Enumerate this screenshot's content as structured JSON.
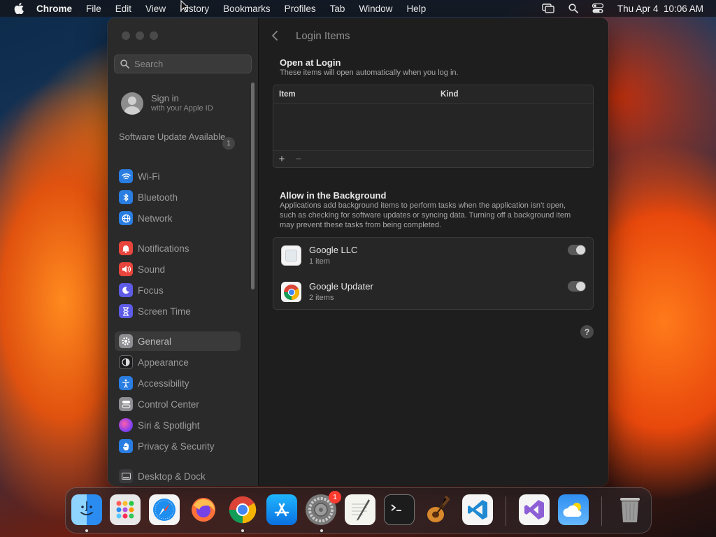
{
  "menubar": {
    "app_name": "Chrome",
    "items": [
      "File",
      "Edit",
      "View",
      "History",
      "Bookmarks",
      "Profiles",
      "Tab",
      "Window",
      "Help"
    ],
    "clock": "Thu Apr 4  10:06 AM",
    "status_icons": [
      "screen-mirroring-icon",
      "spotlight-search-icon",
      "control-center-icon"
    ]
  },
  "sidebar": {
    "search_placeholder": "Search",
    "account": {
      "title": "Sign in",
      "subtitle": "with your Apple ID"
    },
    "software_update": {
      "label": "Software Update Available",
      "badge": "1"
    },
    "items": [
      {
        "label": "Wi-Fi",
        "icon": "wifi-icon",
        "color": "#2a7de1"
      },
      {
        "label": "Bluetooth",
        "icon": "bluetooth-icon",
        "color": "#2a7de1"
      },
      {
        "label": "Network",
        "icon": "globe-icon",
        "color": "#2a7de1"
      },
      {
        "label": "Notifications",
        "icon": "bell-icon",
        "color": "#e8453c"
      },
      {
        "label": "Sound",
        "icon": "speaker-icon",
        "color": "#e8453c"
      },
      {
        "label": "Focus",
        "icon": "moon-icon",
        "color": "#5e5ce6"
      },
      {
        "label": "Screen Time",
        "icon": "hourglass-icon",
        "color": "#5e5ce6"
      },
      {
        "label": "General",
        "icon": "gear-icon",
        "color": "#8e8e93",
        "selected": true
      },
      {
        "label": "Appearance",
        "icon": "appearance-icon",
        "color": "#1c1c1e"
      },
      {
        "label": "Accessibility",
        "icon": "accessibility-icon",
        "color": "#2a7de1"
      },
      {
        "label": "Control Center",
        "icon": "control-center-icon",
        "color": "#8e8e93"
      },
      {
        "label": "Siri & Spotlight",
        "icon": "siri-icon",
        "color": "#b04fd6"
      },
      {
        "label": "Privacy & Security",
        "icon": "hand-icon",
        "color": "#2a7de1"
      },
      {
        "label": "Desktop & Dock",
        "icon": "dock-icon",
        "color": "#3a3a3c"
      }
    ]
  },
  "main": {
    "title": "Login Items",
    "open_at_login": {
      "title": "Open at Login",
      "subtitle": "These items will open automatically when you log in.",
      "columns": [
        "Item",
        "Kind"
      ],
      "add_label": "+",
      "remove_label": "−"
    },
    "background": {
      "title": "Allow in the Background",
      "subtitle": "Applications add background items to perform tasks when the application isn’t open, such as checking for software updates or syncing data. Turning off a background item may prevent these tasks from being completed.",
      "items": [
        {
          "name": "Google LLC",
          "count": "1 item",
          "enabled": true,
          "icon": "generic-app-icon"
        },
        {
          "name": "Google Updater",
          "count": "2 items",
          "enabled": true,
          "icon": "chrome-icon"
        }
      ]
    },
    "help_label": "?"
  },
  "dock": {
    "apps": [
      "finder-icon",
      "launchpad-icon",
      "safari-icon",
      "firefox-icon",
      "chrome-icon",
      "app-store-icon",
      "system-settings-icon",
      "textedit-icon",
      "terminal-icon",
      "garageband-icon",
      "vscode-icon",
      "visual-studio-icon",
      "weather-icon",
      "trash-icon"
    ],
    "settings_badge": "1"
  }
}
